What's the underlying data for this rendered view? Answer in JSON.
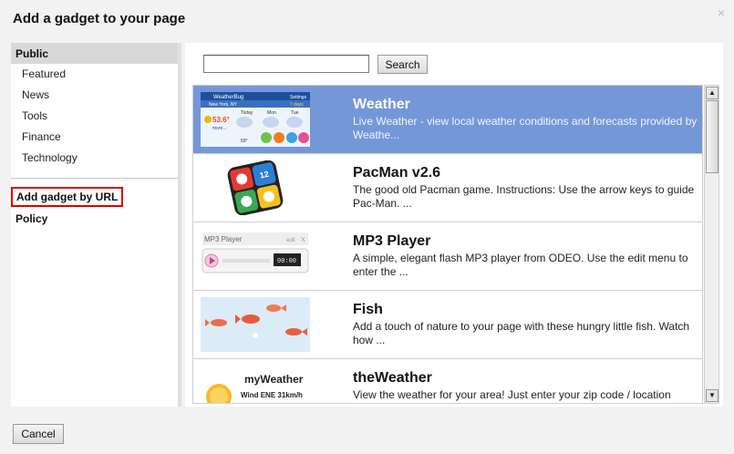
{
  "dialog": {
    "title": "Add a gadget to your page",
    "close_glyph": "×"
  },
  "sidebar": {
    "section": "Public",
    "categories": [
      "Featured",
      "News",
      "Tools",
      "Finance",
      "Technology"
    ],
    "add_by_url": "Add gadget by URL",
    "policy": "Policy"
  },
  "search": {
    "placeholder": "",
    "value": "",
    "button": "Search"
  },
  "gadgets": [
    {
      "name": "Weather",
      "desc": "Live Weather - view local weather conditions and forecasts provided by Weathe...",
      "thumb": {
        "brand": "WeatherBug",
        "settings": "Settings",
        "city": "New York, NY",
        "range": "7 days",
        "temp": "53.6°",
        "more": "more...",
        "days": [
          "Today",
          "Mon",
          "Tue"
        ],
        "low": "59°"
      }
    },
    {
      "name": "PacMan v2.6",
      "desc": "The good old Pacman game. Instructions: Use the arrow keys to guide Pac-Man. ...",
      "thumb": {
        "tile": "12"
      }
    },
    {
      "name": "MP3 Player",
      "desc": "A simple, elegant flash MP3 player from ODEO. Use the edit menu to enter the ...",
      "thumb": {
        "label": "MP3 Player",
        "edit": "edit",
        "close": "X",
        "time": "00:00"
      }
    },
    {
      "name": "Fish",
      "desc": "Add a touch of nature to your page with these hungry little fish. Watch how ..."
    },
    {
      "name": "theWeather",
      "desc": "View the weather for your area! Just enter your zip code / location",
      "thumb": {
        "label": "myWeather",
        "wind": "Wind ENE 31km/h"
      }
    }
  ],
  "footer": {
    "cancel": "Cancel"
  },
  "colors": {
    "selected_row": "#7497d8",
    "add_url_border": "#dd0000"
  }
}
